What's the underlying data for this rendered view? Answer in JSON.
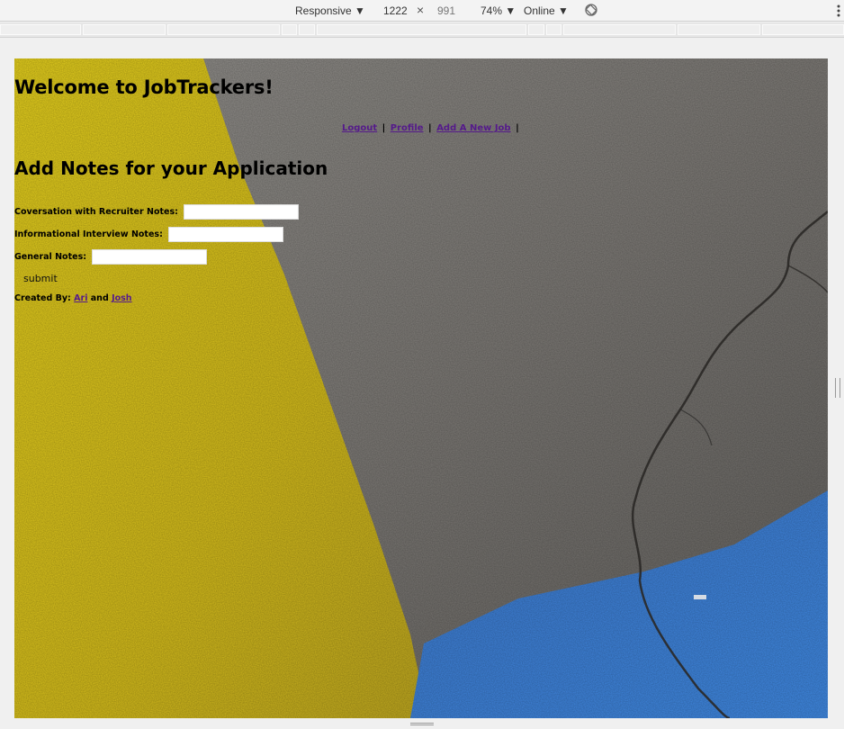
{
  "devtools": {
    "device": "Responsive ▼",
    "width": "1222",
    "times": "×",
    "height": "991",
    "zoom": "74% ▼",
    "throttle": "Online ▼"
  },
  "site": {
    "title": "Welcome to JobTrackers!"
  },
  "nav": {
    "logout": "Logout",
    "profile": "Profile",
    "add_job": "Add A New Job",
    "sep": "|"
  },
  "form": {
    "title": "Add Notes for your Application",
    "recruiter_label": "Coversation with Recruiter Notes:",
    "recruiter_value": "",
    "informational_label": "Informational Interview Notes:",
    "informational_value": "",
    "general_label": "General Notes:",
    "general_value": "",
    "submit_label": "submit"
  },
  "footer": {
    "created_by": "Created By:",
    "author1": "Ari",
    "and": "and",
    "author2": "Josh"
  },
  "colors": {
    "link": "#551a8b",
    "yellow_paint": "#d8c320",
    "concrete": "#7a7874",
    "blue_paint": "#3b7bd0"
  }
}
